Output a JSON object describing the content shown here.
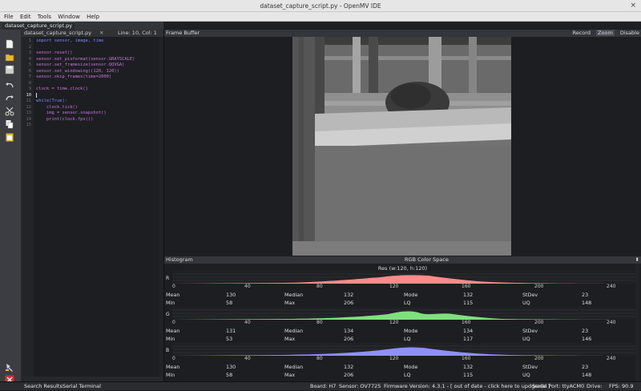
{
  "window": {
    "title": "dataset_capture_script.py - OpenMV IDE",
    "close_glyph": "×"
  },
  "menu": [
    "File",
    "Edit",
    "Tools",
    "Window",
    "Help"
  ],
  "tab": {
    "label": "dataset_capture_script.py"
  },
  "editor": {
    "file": "dataset_capture_script.py",
    "position": "Line: 10, Col: 1",
    "line_numbers": [
      "1",
      "2",
      "3",
      "4",
      "5",
      "6",
      "7",
      "8",
      "9",
      "10",
      "11",
      "12",
      "13",
      "14",
      "15"
    ],
    "current_line": 10,
    "lines": [
      "import sensor, image, time",
      "",
      "sensor.reset()",
      "sensor.set_pixformat(sensor.GRAYSCALE)",
      "sensor.set_framesize(sensor.QQVGA)",
      "sensor.set_windowing((120, 120))",
      "sensor.skip_frames(time=2000)",
      "",
      "clock = time.clock()",
      "",
      "while(True):",
      "    clock.tick()",
      "    img = sensor.snapshot()",
      "    print(clock.fps())",
      ""
    ]
  },
  "toolbar_icons": [
    "new-file-icon",
    "open-file-icon",
    "save-file-icon",
    "undo-icon",
    "redo-icon",
    "cut-icon",
    "copy-icon",
    "paste-icon",
    "connect-icon",
    "stop-icon"
  ],
  "frame_buffer": {
    "label": "Frame Buffer",
    "buttons": [
      "Record",
      "Zoom",
      "Disable"
    ],
    "active_button": "Zoom"
  },
  "histogram": {
    "label": "Histogram",
    "color_space": "RGB Color Space",
    "resolution": "Res (w:120, h:120)",
    "ticks": [
      "0",
      "40",
      "80",
      "120",
      "160",
      "200",
      "240"
    ],
    "channels": [
      {
        "name": "R",
        "color": "#ff8a8a",
        "stats": {
          "Mean": "130",
          "Median": "132",
          "Mode": "132",
          "StDev": "23",
          "Min": "58",
          "Max": "206",
          "LQ": "115",
          "UQ": "148"
        }
      },
      {
        "name": "G",
        "color": "#7ee07e",
        "stats": {
          "Mean": "131",
          "Median": "134",
          "Mode": "134",
          "StDev": "23",
          "Min": "53",
          "Max": "206",
          "LQ": "117",
          "UQ": "146"
        }
      },
      {
        "name": "B",
        "color": "#8f8fff",
        "stats": {
          "Mean": "130",
          "Median": "132",
          "Mode": "132",
          "StDev": "23",
          "Min": "58",
          "Max": "206",
          "LQ": "115",
          "UQ": "148"
        }
      }
    ]
  },
  "statusbar": {
    "search_results": "Search Results",
    "serial_terminal": "Serial Terminal",
    "board": "Board: H7",
    "sensor": "Sensor: OV7725",
    "firmware": "Firmware Version: 4.3.1 - [ out of date - click here to updgrade ]",
    "serial_port": "Serial Port: ttyACM0",
    "drive": "Drive:",
    "fps": "FPS: 90.9"
  }
}
